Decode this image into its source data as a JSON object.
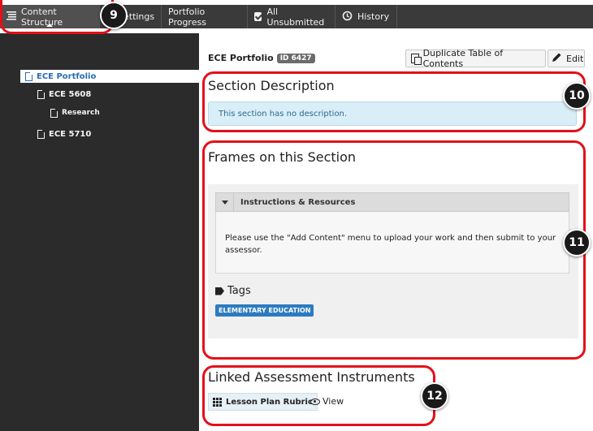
{
  "tabs": [
    {
      "label": "Content Structure",
      "icon": "list-icon"
    },
    {
      "label": "Settings",
      "icon": "none"
    },
    {
      "label": "Portfolio Progress",
      "icon": "none"
    },
    {
      "label": "All Unsubmitted",
      "icon": "checkbox-icon"
    },
    {
      "label": "History",
      "icon": "history-icon"
    }
  ],
  "tree": [
    {
      "label": "ECE Portfolio",
      "selected": true
    },
    {
      "label": "ECE 5608",
      "selected": false
    },
    {
      "label": "Research",
      "selected": false
    },
    {
      "label": "ECE 5710",
      "selected": false
    }
  ],
  "header": {
    "portfolio_title": "ECE Portfolio",
    "id_badge": "ID 6427",
    "duplicate_label": "Duplicate Table of Contents",
    "edit_label": "Edit"
  },
  "description": {
    "title": "Section Description",
    "text": "This section has no description."
  },
  "frames": {
    "title": "Frames on this Section",
    "header": "Instructions & Resources",
    "body": "Please use the \"Add Content\" menu to upload your work and then submit to your assessor.",
    "tags_title": "Tags",
    "tag": "ELEMENTARY EDUCATION"
  },
  "linked": {
    "title": "Linked Assessment Instruments",
    "rubric_label": "Lesson Plan Rubric",
    "view_label": "View"
  },
  "callouts": [
    "9",
    "10",
    "11",
    "12"
  ],
  "colors": {
    "callout": "#e3101a",
    "accent": "#2d7bbf",
    "sidebar": "#2b2b2b"
  }
}
